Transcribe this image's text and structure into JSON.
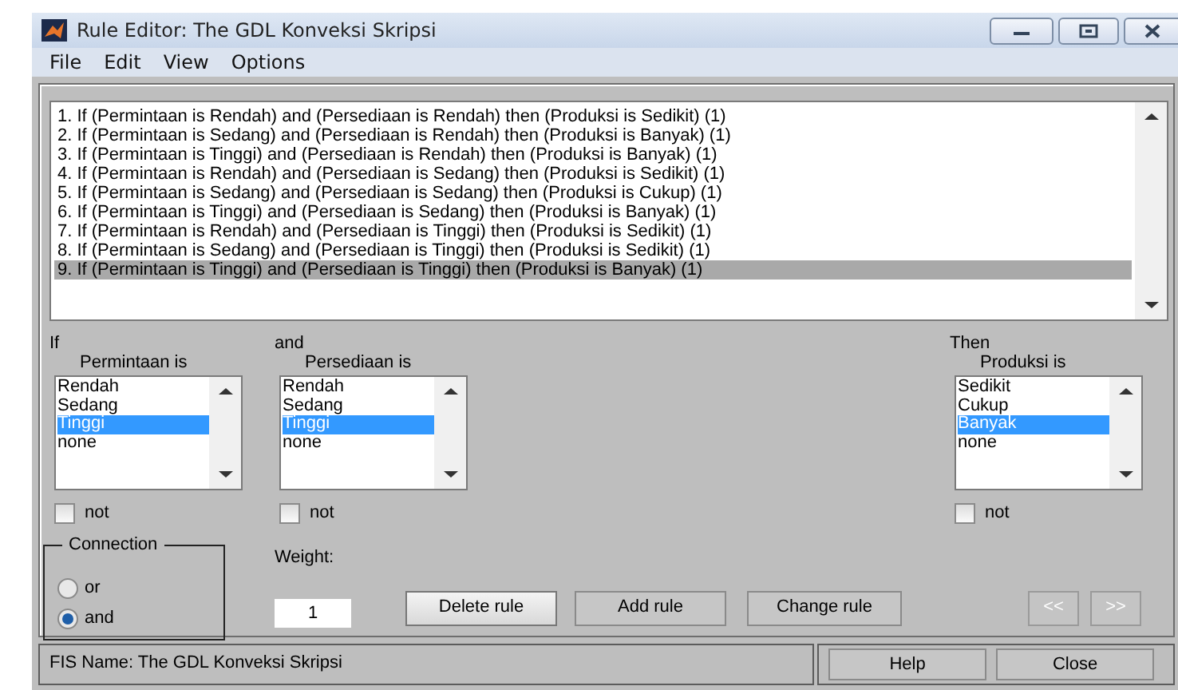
{
  "window": {
    "title": "Rule Editor: The GDL Konveksi Skripsi"
  },
  "menu": [
    "File",
    "Edit",
    "View",
    "Options"
  ],
  "rules": [
    {
      "text": "1. If (Permintaan is Rendah) and (Persediaan is Rendah) then (Produksi is Sedikit) (1)",
      "selected": false
    },
    {
      "text": "2. If (Permintaan is Sedang) and (Persediaan is Rendah) then (Produksi is Banyak) (1)",
      "selected": false
    },
    {
      "text": "3. If (Permintaan is Tinggi) and (Persediaan is Rendah) then (Produksi is Banyak) (1)",
      "selected": false
    },
    {
      "text": "4. If (Permintaan is Rendah) and (Persediaan is Sedang) then (Produksi is Sedikit) (1)",
      "selected": false
    },
    {
      "text": "5. If (Permintaan is Sedang) and (Persediaan is Sedang) then (Produksi is Cukup) (1)",
      "selected": false
    },
    {
      "text": "6. If (Permintaan is Tinggi) and (Persediaan is Sedang) then (Produksi is Banyak) (1)",
      "selected": false
    },
    {
      "text": "7. If (Permintaan is Rendah) and (Persediaan is Tinggi) then (Produksi is Sedikit) (1)",
      "selected": false
    },
    {
      "text": "8. If (Permintaan is Sedang) and (Persediaan is Tinggi) then (Produksi is Sedikit) (1)",
      "selected": false
    },
    {
      "text": "9. If (Permintaan is Tinggi) and (Persediaan is Tinggi) then (Produksi is Banyak) (1)",
      "selected": true
    }
  ],
  "variables": [
    {
      "kind": "input",
      "connector": "If",
      "label": "Permintaan is",
      "options": [
        {
          "text": "Rendah",
          "selected": false
        },
        {
          "text": "Sedang",
          "selected": false
        },
        {
          "text": "Tinggi",
          "selected": true
        },
        {
          "text": "none",
          "selected": false
        }
      ],
      "not": {
        "label": "not",
        "checked": false
      }
    },
    {
      "kind": "input",
      "connector": "and",
      "label": "Persediaan is",
      "options": [
        {
          "text": "Rendah",
          "selected": false
        },
        {
          "text": "Sedang",
          "selected": false
        },
        {
          "text": "Tinggi",
          "selected": true
        },
        {
          "text": "none",
          "selected": false
        }
      ],
      "not": {
        "label": "not",
        "checked": false
      }
    },
    {
      "kind": "output",
      "connector": "Then",
      "label": "Produksi is",
      "options": [
        {
          "text": "Sedikit",
          "selected": false
        },
        {
          "text": "Cukup",
          "selected": false
        },
        {
          "text": "Banyak",
          "selected": true
        },
        {
          "text": "none",
          "selected": false
        }
      ],
      "not": {
        "label": "not",
        "checked": false
      }
    }
  ],
  "connection": {
    "title": "Connection",
    "options": [
      {
        "label": "or",
        "selected": false
      },
      {
        "label": "and",
        "selected": true
      }
    ]
  },
  "weight": {
    "label": "Weight:",
    "value": "1"
  },
  "rule_buttons": [
    {
      "label": "Delete rule",
      "focused": true
    },
    {
      "label": "Add rule",
      "focused": false
    },
    {
      "label": "Change rule",
      "focused": false
    }
  ],
  "nav_buttons": [
    {
      "label": "<<",
      "disabled": true
    },
    {
      "label": ">>",
      "disabled": true
    }
  ],
  "status": "FIS Name: The GDL Konveksi Skripsi",
  "footer_buttons": [
    "Help",
    "Close"
  ]
}
